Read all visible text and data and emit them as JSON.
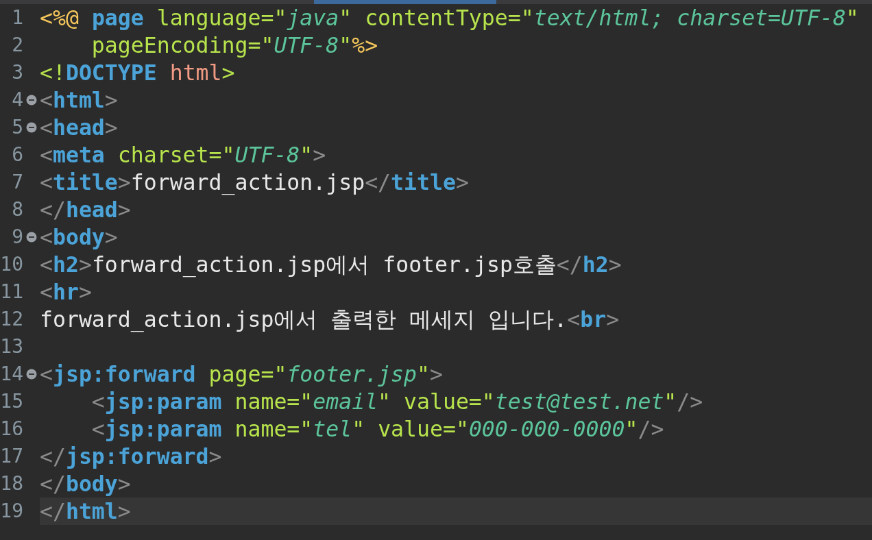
{
  "editor": {
    "lines": [
      {
        "number": "1",
        "foldable": false,
        "current": false,
        "tokens": [
          {
            "kind": "jsp",
            "text": "<%@"
          },
          {
            "kind": "keyword",
            "text": "page",
            "space_before": true
          },
          {
            "kind": "attr",
            "text": "language=",
            "space_before": true
          },
          {
            "kind": "quote",
            "text": "\""
          },
          {
            "kind": "string",
            "text": "java"
          },
          {
            "kind": "quote",
            "text": "\""
          },
          {
            "kind": "attr",
            "text": "contentType=",
            "space_before": true
          },
          {
            "kind": "quote",
            "text": "\""
          },
          {
            "kind": "string",
            "text": "text/html; charset=UTF-8"
          },
          {
            "kind": "quote",
            "text": "\""
          }
        ]
      },
      {
        "number": "2",
        "foldable": false,
        "current": false,
        "indent": true,
        "tokens": [
          {
            "kind": "attr",
            "text": "pageEncoding="
          },
          {
            "kind": "quote",
            "text": "\""
          },
          {
            "kind": "string",
            "text": "UTF-8"
          },
          {
            "kind": "quote",
            "text": "\""
          },
          {
            "kind": "jsp",
            "text": "%>"
          }
        ]
      },
      {
        "number": "3",
        "foldable": false,
        "current": false,
        "tokens": [
          {
            "kind": "attr",
            "text": "<!"
          },
          {
            "kind": "keyword",
            "text": "DOCTYPE"
          },
          {
            "kind": "doctype",
            "text": "html",
            "space_before": true
          },
          {
            "kind": "attr",
            "text": ">"
          }
        ]
      },
      {
        "number": "4",
        "foldable": true,
        "current": false,
        "tokens": [
          {
            "kind": "bracket",
            "text": "<"
          },
          {
            "kind": "keyword",
            "text": "html"
          },
          {
            "kind": "bracket",
            "text": ">"
          }
        ]
      },
      {
        "number": "5",
        "foldable": true,
        "current": false,
        "tokens": [
          {
            "kind": "bracket",
            "text": "<"
          },
          {
            "kind": "keyword",
            "text": "head"
          },
          {
            "kind": "bracket",
            "text": ">"
          }
        ]
      },
      {
        "number": "6",
        "foldable": false,
        "current": false,
        "tokens": [
          {
            "kind": "bracket",
            "text": "<"
          },
          {
            "kind": "keyword",
            "text": "meta"
          },
          {
            "kind": "attr",
            "text": "charset=",
            "space_before": true
          },
          {
            "kind": "quote",
            "text": "\""
          },
          {
            "kind": "string",
            "text": "UTF-8"
          },
          {
            "kind": "quote",
            "text": "\""
          },
          {
            "kind": "bracket",
            "text": ">"
          }
        ]
      },
      {
        "number": "7",
        "foldable": false,
        "current": false,
        "tokens": [
          {
            "kind": "bracket",
            "text": "<"
          },
          {
            "kind": "keyword",
            "text": "title"
          },
          {
            "kind": "bracket",
            "text": ">"
          },
          {
            "kind": "text",
            "text": "forward_action.jsp"
          },
          {
            "kind": "bracket",
            "text": "</"
          },
          {
            "kind": "keyword",
            "text": "title"
          },
          {
            "kind": "bracket",
            "text": ">"
          }
        ]
      },
      {
        "number": "8",
        "foldable": false,
        "current": false,
        "tokens": [
          {
            "kind": "bracket",
            "text": "</"
          },
          {
            "kind": "keyword",
            "text": "head"
          },
          {
            "kind": "bracket",
            "text": ">"
          }
        ]
      },
      {
        "number": "9",
        "foldable": true,
        "current": false,
        "tokens": [
          {
            "kind": "bracket",
            "text": "<"
          },
          {
            "kind": "keyword",
            "text": "body"
          },
          {
            "kind": "bracket",
            "text": ">"
          }
        ]
      },
      {
        "number": "10",
        "foldable": false,
        "current": false,
        "tokens": [
          {
            "kind": "bracket",
            "text": "<"
          },
          {
            "kind": "keyword",
            "text": "h2"
          },
          {
            "kind": "bracket",
            "text": ">"
          },
          {
            "kind": "text",
            "text": "forward_action.jsp에서 footer.jsp호출"
          },
          {
            "kind": "bracket",
            "text": "</"
          },
          {
            "kind": "keyword",
            "text": "h2"
          },
          {
            "kind": "bracket",
            "text": ">"
          }
        ]
      },
      {
        "number": "11",
        "foldable": false,
        "current": false,
        "tokens": [
          {
            "kind": "bracket",
            "text": "<"
          },
          {
            "kind": "keyword",
            "text": "hr"
          },
          {
            "kind": "bracket",
            "text": ">"
          }
        ]
      },
      {
        "number": "12",
        "foldable": false,
        "current": false,
        "tokens": [
          {
            "kind": "text",
            "text": "forward_action.jsp에서 출력한 메세지 입니다."
          },
          {
            "kind": "bracket",
            "text": "<"
          },
          {
            "kind": "keyword",
            "text": "br"
          },
          {
            "kind": "bracket",
            "text": ">"
          }
        ]
      },
      {
        "number": "13",
        "foldable": false,
        "current": false
      },
      {
        "number": "14",
        "foldable": true,
        "current": false,
        "tokens": [
          {
            "kind": "bracket",
            "text": "<"
          },
          {
            "kind": "keyword",
            "text": "jsp:forward"
          },
          {
            "kind": "attr",
            "text": "page=",
            "space_before": true
          },
          {
            "kind": "quote",
            "text": "\""
          },
          {
            "kind": "string",
            "text": "footer.jsp"
          },
          {
            "kind": "quote",
            "text": "\""
          },
          {
            "kind": "bracket",
            "text": ">"
          }
        ]
      },
      {
        "number": "15",
        "foldable": false,
        "current": false,
        "indent": true,
        "tokens": [
          {
            "kind": "bracket",
            "text": "<"
          },
          {
            "kind": "keyword",
            "text": "jsp:param"
          },
          {
            "kind": "attr",
            "text": "name=",
            "space_before": true
          },
          {
            "kind": "quote",
            "text": "\""
          },
          {
            "kind": "string",
            "text": "email"
          },
          {
            "kind": "quote",
            "text": "\""
          },
          {
            "kind": "attr",
            "text": "value=",
            "space_before": true
          },
          {
            "kind": "quote",
            "text": "\""
          },
          {
            "kind": "string",
            "text": "test@test.net"
          },
          {
            "kind": "quote",
            "text": "\""
          },
          {
            "kind": "bracket",
            "text": "/>"
          }
        ]
      },
      {
        "number": "16",
        "foldable": false,
        "current": false,
        "indent": true,
        "tokens": [
          {
            "kind": "bracket",
            "text": "<"
          },
          {
            "kind": "keyword",
            "text": "jsp:param"
          },
          {
            "kind": "attr",
            "text": "name=",
            "space_before": true
          },
          {
            "kind": "quote",
            "text": "\""
          },
          {
            "kind": "string",
            "text": "tel"
          },
          {
            "kind": "quote",
            "text": "\""
          },
          {
            "kind": "attr",
            "text": "value=",
            "space_before": true
          },
          {
            "kind": "quote",
            "text": "\""
          },
          {
            "kind": "string",
            "text": "000-000-0000"
          },
          {
            "kind": "quote",
            "text": "\""
          },
          {
            "kind": "bracket",
            "text": "/>"
          }
        ]
      },
      {
        "number": "17",
        "foldable": false,
        "current": false,
        "tokens": [
          {
            "kind": "bracket",
            "text": "</"
          },
          {
            "kind": "keyword",
            "text": "jsp:forward"
          },
          {
            "kind": "bracket",
            "text": ">"
          }
        ]
      },
      {
        "number": "18",
        "foldable": false,
        "current": false,
        "tokens": [
          {
            "kind": "bracket",
            "text": "</"
          },
          {
            "kind": "keyword",
            "text": "body"
          },
          {
            "kind": "bracket",
            "text": ">"
          }
        ]
      },
      {
        "number": "19",
        "foldable": false,
        "current": true,
        "tokens": [
          {
            "kind": "bracket",
            "text": "</"
          },
          {
            "kind": "keyword",
            "text": "html"
          },
          {
            "kind": "bracket",
            "text": ">"
          }
        ]
      }
    ]
  }
}
